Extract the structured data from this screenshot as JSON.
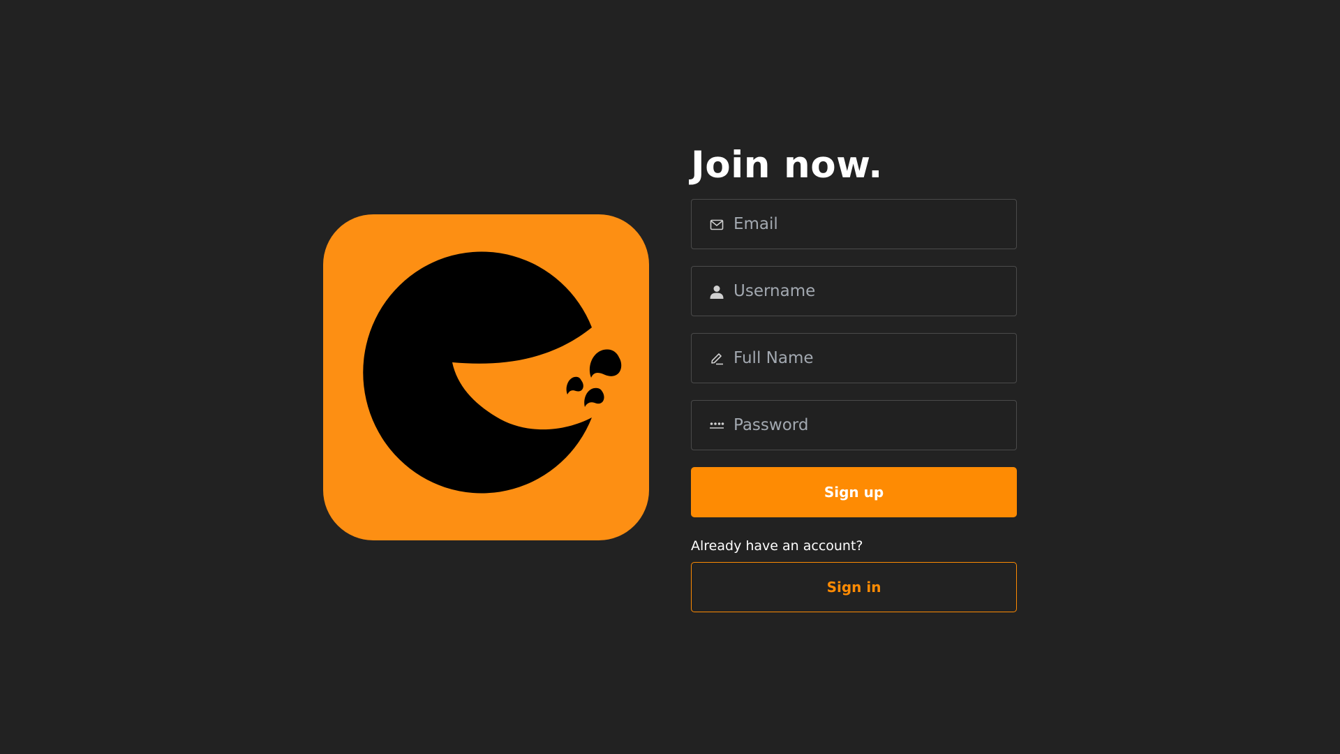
{
  "logo": {
    "icon": "app-logo",
    "background_color": "#FD8F13",
    "foreground_color": "#000000"
  },
  "form": {
    "title": "Join now.",
    "fields": [
      {
        "icon": "envelope-icon",
        "placeholder": "Email",
        "value": ""
      },
      {
        "icon": "person-icon",
        "placeholder": "Username",
        "value": ""
      },
      {
        "icon": "pencil-icon",
        "placeholder": "Full Name",
        "value": ""
      },
      {
        "icon": "password-dots-icon",
        "placeholder": "Password",
        "value": ""
      }
    ],
    "signup_label": "Sign up",
    "signin_prompt": "Already have an account?",
    "signin_label": "Sign in"
  },
  "colors": {
    "background": "#222222",
    "accent": "#FE8B03",
    "field_border": "#4B4B4B",
    "placeholder": "#A3A9B1"
  }
}
